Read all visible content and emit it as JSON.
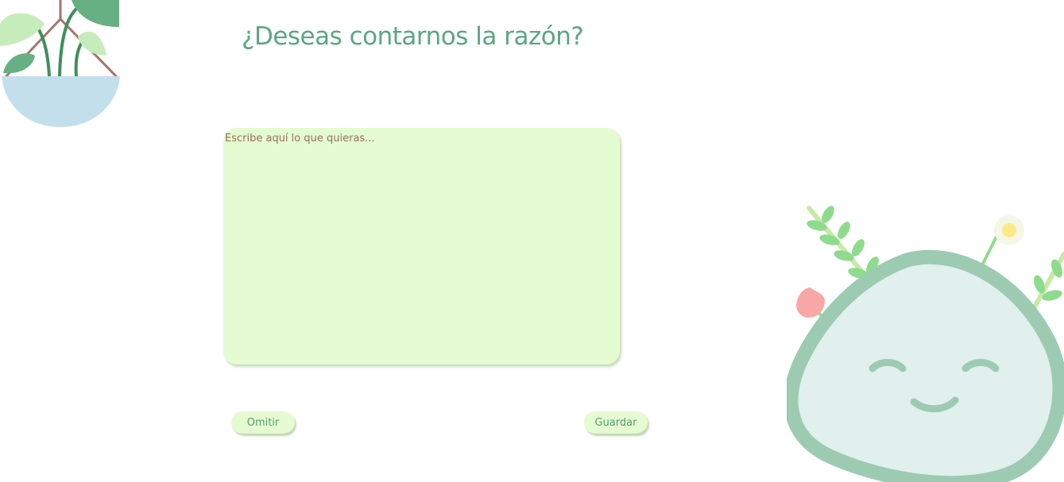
{
  "page": {
    "title": "¿Deseas contarnos la razón?"
  },
  "form": {
    "reason_placeholder": "Escribe aquí lo que quieras...",
    "reason_value": ""
  },
  "actions": {
    "omit_label": "Omitir",
    "save_label": "Guardar"
  },
  "illustrations": {
    "top_left": "hanging-plant-icon",
    "bottom_right": "smiling-blob-with-plants-icon"
  },
  "colors": {
    "title": "#5aa77f",
    "textarea_bg": "#e5fbd1",
    "placeholder": "#95715a",
    "button_text": "#5a9a72",
    "blob_outline": "#9ccbb2",
    "blob_fill": "#e1efed",
    "pot": "#c4dfec"
  }
}
